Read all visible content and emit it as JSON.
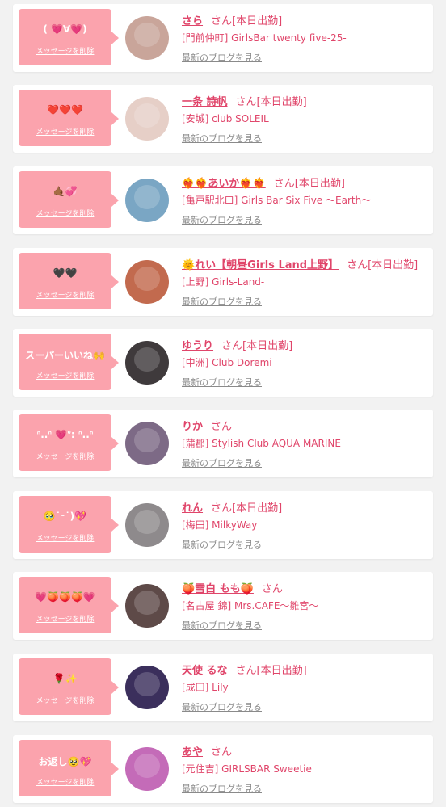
{
  "ui": {
    "delete_label": "メッセージを削除",
    "honorific": "さん",
    "blog_label": "最新のブログを見る"
  },
  "colors": {
    "accent_pink": "#fba3ad",
    "name_pink": "#e0456a",
    "link_gray": "#8a8a8a"
  },
  "messages": [
    {
      "message": "( 💗∀💗)",
      "name": "さら",
      "work_status": "[本日出勤]",
      "shop": "[門前仲町] GirlsBar twenty five-25-",
      "avatar_icon": "profile-photo-icon",
      "avatar_color": "#c9a59a"
    },
    {
      "message": "❤️❤️❤️",
      "name": "一条 詩帆",
      "work_status": "[本日出勤]",
      "shop": "[安城] club SOLEIL",
      "avatar_icon": "profile-photo-icon",
      "avatar_color": "#e6cfc7"
    },
    {
      "message": "🤙🏾💞",
      "name": "❤️‍🔥❤️‍🔥あいか❤️‍🔥❤️‍🔥",
      "work_status": "[本日出勤]",
      "shop": "[亀戸駅北口] Girls Bar Six Five 〜Earth〜",
      "avatar_icon": "profile-photo-icon",
      "avatar_color": "#7aa6c4"
    },
    {
      "message": "🖤🖤",
      "name": "🌞れい【朝昼Girls Land上野】",
      "work_status": "[本日出勤]",
      "shop": "[上野] Girls-Land-",
      "avatar_icon": "profile-photo-icon",
      "avatar_color": "#c26a4e"
    },
    {
      "message": "スーパーいいね🙌",
      "name": "ゆうり",
      "work_status": "[本日出勤]",
      "shop": "[中洲] Club Doremi",
      "avatar_icon": "profile-photo-icon",
      "avatar_color": "#3f3a3c"
    },
    {
      "message": "ᐢ..ᐢ 💗ᐡ: ᐢ..ᐢ",
      "name": "りか",
      "work_status": "",
      "shop": "[蒲郡] Stylish Club AQUA MARINE",
      "avatar_icon": "profile-photo-icon",
      "avatar_color": "#7d6a86"
    },
    {
      "message": "🥹˙ᵕ˙)💖",
      "name": "れん",
      "work_status": "[本日出勤]",
      "shop": "[梅田] MilkyWay",
      "avatar_icon": "profile-photo-icon",
      "avatar_color": "#8e8a8c"
    },
    {
      "message": "💗🍑🍑🍑💗",
      "name": "🍑雪白 もも🍑",
      "work_status": "",
      "shop": "[名古屋 錦] Mrs.CAFE〜雛宮〜",
      "avatar_icon": "profile-photo-icon",
      "avatar_color": "#5e4a48"
    },
    {
      "message": "🌹✨",
      "name": "天使 るな",
      "work_status": "[本日出勤]",
      "shop": "[成田] Lily",
      "avatar_icon": "profile-photo-icon",
      "avatar_color": "#3b2f5c"
    },
    {
      "message": "お返し🥹💖",
      "name": "あや",
      "work_status": "",
      "shop": "[元住吉] GIRLSBAR Sweetie",
      "avatar_icon": "profile-photo-icon",
      "avatar_color": "#c46bb8"
    }
  ]
}
